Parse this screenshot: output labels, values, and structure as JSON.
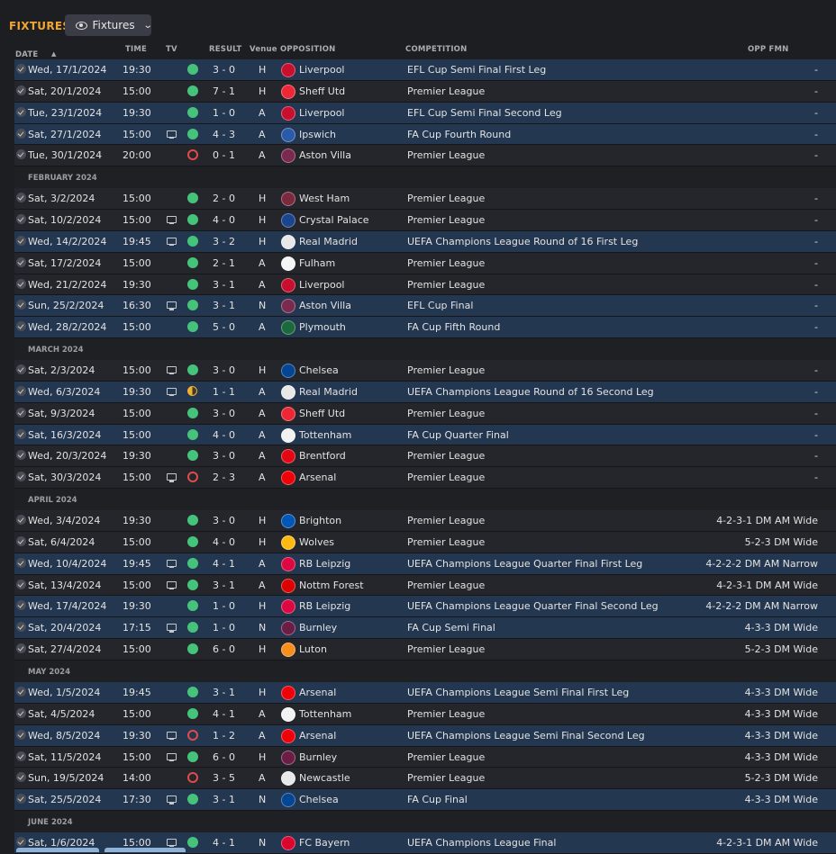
{
  "page": {
    "title": "FIXTURES",
    "view_label": "Fixtures"
  },
  "headers": {
    "date": "DATE",
    "time": "TIME",
    "tv": "TV",
    "result": "RESULT",
    "venue": "Venue",
    "opposition": "OPPOSITION",
    "competition": "COMPETITION",
    "opp_fmn": "OPP FMN"
  },
  "colors": {
    "accent": "#f0a630",
    "win": "#45c37a",
    "loss": "#e04b4b",
    "draw": "#f0b030",
    "row_highlight": "#243751",
    "row_default": "#25262b",
    "background": "#1d1e22"
  },
  "rows": [
    {
      "type": "fixture",
      "date": "Wed, 17/1/2024",
      "time": "19:30",
      "tv": false,
      "outcome": "W",
      "result": "3 - 0",
      "venue": "H",
      "opposition": "Liverpool",
      "crest_color": "#c8102e",
      "competition": "EFL Cup Semi Final First Leg",
      "fmn": "-",
      "hl": true
    },
    {
      "type": "fixture",
      "date": "Sat, 20/1/2024",
      "time": "15:00",
      "tv": false,
      "outcome": "W",
      "result": "7 - 1",
      "venue": "H",
      "opposition": "Sheff Utd",
      "crest_color": "#ee2737",
      "competition": "Premier League",
      "fmn": "-",
      "hl": false
    },
    {
      "type": "fixture",
      "date": "Tue, 23/1/2024",
      "time": "19:30",
      "tv": false,
      "outcome": "W",
      "result": "1 - 0",
      "venue": "A",
      "opposition": "Liverpool",
      "crest_color": "#c8102e",
      "competition": "EFL Cup Semi Final Second Leg",
      "fmn": "-",
      "hl": true
    },
    {
      "type": "fixture",
      "date": "Sat, 27/1/2024",
      "time": "15:00",
      "tv": true,
      "outcome": "W",
      "result": "4 - 3",
      "venue": "A",
      "opposition": "Ipswich",
      "crest_color": "#2a5aa8",
      "competition": "FA Cup Fourth Round",
      "fmn": "-",
      "hl": true
    },
    {
      "type": "fixture",
      "date": "Tue, 30/1/2024",
      "time": "20:00",
      "tv": false,
      "outcome": "L",
      "result": "0 - 1",
      "venue": "A",
      "opposition": "Aston Villa",
      "crest_color": "#7a2a4e",
      "competition": "Premier League",
      "fmn": "-",
      "hl": false
    },
    {
      "type": "month",
      "label": "FEBRUARY 2024"
    },
    {
      "type": "fixture",
      "date": "Sat, 3/2/2024",
      "time": "15:00",
      "tv": false,
      "outcome": "W",
      "result": "2 - 0",
      "venue": "H",
      "opposition": "West Ham",
      "crest_color": "#7a2a3e",
      "competition": "Premier League",
      "fmn": "-",
      "hl": false
    },
    {
      "type": "fixture",
      "date": "Sat, 10/2/2024",
      "time": "15:00",
      "tv": true,
      "outcome": "W",
      "result": "4 - 0",
      "venue": "H",
      "opposition": "Crystal Palace",
      "crest_color": "#1b458f",
      "competition": "Premier League",
      "fmn": "-",
      "hl": false
    },
    {
      "type": "fixture",
      "date": "Wed, 14/2/2024",
      "time": "19:45",
      "tv": true,
      "outcome": "W",
      "result": "3 - 2",
      "venue": "H",
      "opposition": "Real Madrid",
      "crest_color": "#e8e8e8",
      "competition": "UEFA Champions League Round of 16 First Leg",
      "fmn": "-",
      "hl": true
    },
    {
      "type": "fixture",
      "date": "Sat, 17/2/2024",
      "time": "15:00",
      "tv": false,
      "outcome": "W",
      "result": "2 - 1",
      "venue": "A",
      "opposition": "Fulham",
      "crest_color": "#f5f5f5",
      "competition": "Premier League",
      "fmn": "-",
      "hl": false
    },
    {
      "type": "fixture",
      "date": "Wed, 21/2/2024",
      "time": "19:30",
      "tv": false,
      "outcome": "W",
      "result": "3 - 1",
      "venue": "A",
      "opposition": "Liverpool",
      "crest_color": "#c8102e",
      "competition": "Premier League",
      "fmn": "-",
      "hl": false
    },
    {
      "type": "fixture",
      "date": "Sun, 25/2/2024",
      "time": "16:30",
      "tv": true,
      "outcome": "W",
      "result": "3 - 1",
      "venue": "N",
      "opposition": "Aston Villa",
      "crest_color": "#7a2a4e",
      "competition": "EFL Cup Final",
      "fmn": "-",
      "hl": true
    },
    {
      "type": "fixture",
      "date": "Wed, 28/2/2024",
      "time": "15:00",
      "tv": false,
      "outcome": "W",
      "result": "5 - 0",
      "venue": "A",
      "opposition": "Plymouth",
      "crest_color": "#1b6a3c",
      "competition": "FA Cup Fifth Round",
      "fmn": "-",
      "hl": true
    },
    {
      "type": "month",
      "label": "MARCH 2024"
    },
    {
      "type": "fixture",
      "date": "Sat, 2/3/2024",
      "time": "15:00",
      "tv": true,
      "outcome": "W",
      "result": "3 - 0",
      "venue": "H",
      "opposition": "Chelsea",
      "crest_color": "#034694",
      "competition": "Premier League",
      "fmn": "-",
      "hl": false
    },
    {
      "type": "fixture",
      "date": "Wed, 6/3/2024",
      "time": "19:30",
      "tv": true,
      "outcome": "D",
      "result": "1 - 1",
      "venue": "A",
      "opposition": "Real Madrid",
      "crest_color": "#e8e8e8",
      "competition": "UEFA Champions League Round of 16 Second Leg",
      "fmn": "-",
      "hl": true
    },
    {
      "type": "fixture",
      "date": "Sat, 9/3/2024",
      "time": "15:00",
      "tv": false,
      "outcome": "W",
      "result": "3 - 0",
      "venue": "A",
      "opposition": "Sheff Utd",
      "crest_color": "#ee2737",
      "competition": "Premier League",
      "fmn": "-",
      "hl": false
    },
    {
      "type": "fixture",
      "date": "Sat, 16/3/2024",
      "time": "15:00",
      "tv": false,
      "outcome": "W",
      "result": "4 - 0",
      "venue": "A",
      "opposition": "Tottenham",
      "crest_color": "#f2f2f2",
      "competition": "FA Cup Quarter Final",
      "fmn": "-",
      "hl": true
    },
    {
      "type": "fixture",
      "date": "Wed, 20/3/2024",
      "time": "19:30",
      "tv": false,
      "outcome": "W",
      "result": "3 - 0",
      "venue": "A",
      "opposition": "Brentford",
      "crest_color": "#e30613",
      "competition": "Premier League",
      "fmn": "-",
      "hl": false
    },
    {
      "type": "fixture",
      "date": "Sat, 30/3/2024",
      "time": "15:00",
      "tv": true,
      "outcome": "L",
      "result": "2 - 3",
      "venue": "A",
      "opposition": "Arsenal",
      "crest_color": "#ef0107",
      "competition": "Premier League",
      "fmn": "-",
      "hl": false
    },
    {
      "type": "month",
      "label": "APRIL 2024"
    },
    {
      "type": "fixture",
      "date": "Wed, 3/4/2024",
      "time": "19:30",
      "tv": false,
      "outcome": "W",
      "result": "3 - 0",
      "venue": "H",
      "opposition": "Brighton",
      "crest_color": "#0057b8",
      "competition": "Premier League",
      "fmn": "4-2-3-1 DM AM Wide",
      "hl": false
    },
    {
      "type": "fixture",
      "date": "Sat, 6/4/2024",
      "time": "15:00",
      "tv": false,
      "outcome": "W",
      "result": "4 - 0",
      "venue": "H",
      "opposition": "Wolves",
      "crest_color": "#fdb913",
      "competition": "Premier League",
      "fmn": "5-2-3 DM Wide",
      "hl": false
    },
    {
      "type": "fixture",
      "date": "Wed, 10/4/2024",
      "time": "19:45",
      "tv": true,
      "outcome": "W",
      "result": "4 - 1",
      "venue": "A",
      "opposition": "RB Leipzig",
      "crest_color": "#dd0741",
      "competition": "UEFA Champions League Quarter Final First Leg",
      "fmn": "4-2-2-2 DM AM Narrow",
      "hl": true
    },
    {
      "type": "fixture",
      "date": "Sat, 13/4/2024",
      "time": "15:00",
      "tv": true,
      "outcome": "W",
      "result": "3 - 1",
      "venue": "A",
      "opposition": "Nottm Forest",
      "crest_color": "#dd0000",
      "competition": "Premier League",
      "fmn": "4-2-3-1 DM AM Wide",
      "hl": false
    },
    {
      "type": "fixture",
      "date": "Wed, 17/4/2024",
      "time": "19:30",
      "tv": false,
      "outcome": "W",
      "result": "1 - 0",
      "venue": "H",
      "opposition": "RB Leipzig",
      "crest_color": "#dd0741",
      "competition": "UEFA Champions League Quarter Final Second Leg",
      "fmn": "4-2-2-2 DM AM Narrow",
      "hl": true
    },
    {
      "type": "fixture",
      "date": "Sat, 20/4/2024",
      "time": "17:15",
      "tv": true,
      "outcome": "W",
      "result": "1 - 0",
      "venue": "N",
      "opposition": "Burnley",
      "crest_color": "#6c1d45",
      "competition": "FA Cup Semi Final",
      "fmn": "4-3-3 DM Wide",
      "hl": true
    },
    {
      "type": "fixture",
      "date": "Sat, 27/4/2024",
      "time": "15:00",
      "tv": false,
      "outcome": "W",
      "result": "6 - 0",
      "venue": "H",
      "opposition": "Luton",
      "crest_color": "#f78f1e",
      "competition": "Premier League",
      "fmn": "5-2-3 DM Wide",
      "hl": false
    },
    {
      "type": "month",
      "label": "MAY 2024"
    },
    {
      "type": "fixture",
      "date": "Wed, 1/5/2024",
      "time": "19:45",
      "tv": false,
      "outcome": "W",
      "result": "3 - 1",
      "venue": "H",
      "opposition": "Arsenal",
      "crest_color": "#ef0107",
      "competition": "UEFA Champions League Semi Final First Leg",
      "fmn": "4-3-3 DM Wide",
      "hl": true
    },
    {
      "type": "fixture",
      "date": "Sat, 4/5/2024",
      "time": "15:00",
      "tv": false,
      "outcome": "W",
      "result": "4 - 1",
      "venue": "A",
      "opposition": "Tottenham",
      "crest_color": "#f2f2f2",
      "competition": "Premier League",
      "fmn": "4-3-3 DM Wide",
      "hl": false
    },
    {
      "type": "fixture",
      "date": "Wed, 8/5/2024",
      "time": "19:30",
      "tv": true,
      "outcome": "L",
      "result": "1 - 2",
      "venue": "A",
      "opposition": "Arsenal",
      "crest_color": "#ef0107",
      "competition": "UEFA Champions League Semi Final Second Leg",
      "fmn": "4-3-3 DM Wide",
      "hl": true
    },
    {
      "type": "fixture",
      "date": "Sat, 11/5/2024",
      "time": "15:00",
      "tv": true,
      "outcome": "W",
      "result": "6 - 0",
      "venue": "H",
      "opposition": "Burnley",
      "crest_color": "#6c1d45",
      "competition": "Premier League",
      "fmn": "4-3-3 DM Wide",
      "hl": false
    },
    {
      "type": "fixture",
      "date": "Sun, 19/5/2024",
      "time": "14:00",
      "tv": false,
      "outcome": "L",
      "result": "3 - 5",
      "venue": "A",
      "opposition": "Newcastle",
      "crest_color": "#e8e8e8",
      "competition": "Premier League",
      "fmn": "5-2-3 DM Wide",
      "hl": false
    },
    {
      "type": "fixture",
      "date": "Sat, 25/5/2024",
      "time": "17:30",
      "tv": true,
      "outcome": "W",
      "result": "3 - 1",
      "venue": "N",
      "opposition": "Chelsea",
      "crest_color": "#034694",
      "competition": "FA Cup Final",
      "fmn": "4-3-3 DM Wide",
      "hl": true
    },
    {
      "type": "month",
      "label": "JUNE 2024"
    },
    {
      "type": "fixture",
      "date": "Sat, 1/6/2024",
      "time": "15:00",
      "tv": true,
      "outcome": "W",
      "result": "4 - 1",
      "venue": "N",
      "opposition": "FC Bayern",
      "crest_color": "#dc052d",
      "competition": "UEFA Champions League Final",
      "fmn": "4-2-3-1 DM AM Wide",
      "hl": true
    }
  ]
}
